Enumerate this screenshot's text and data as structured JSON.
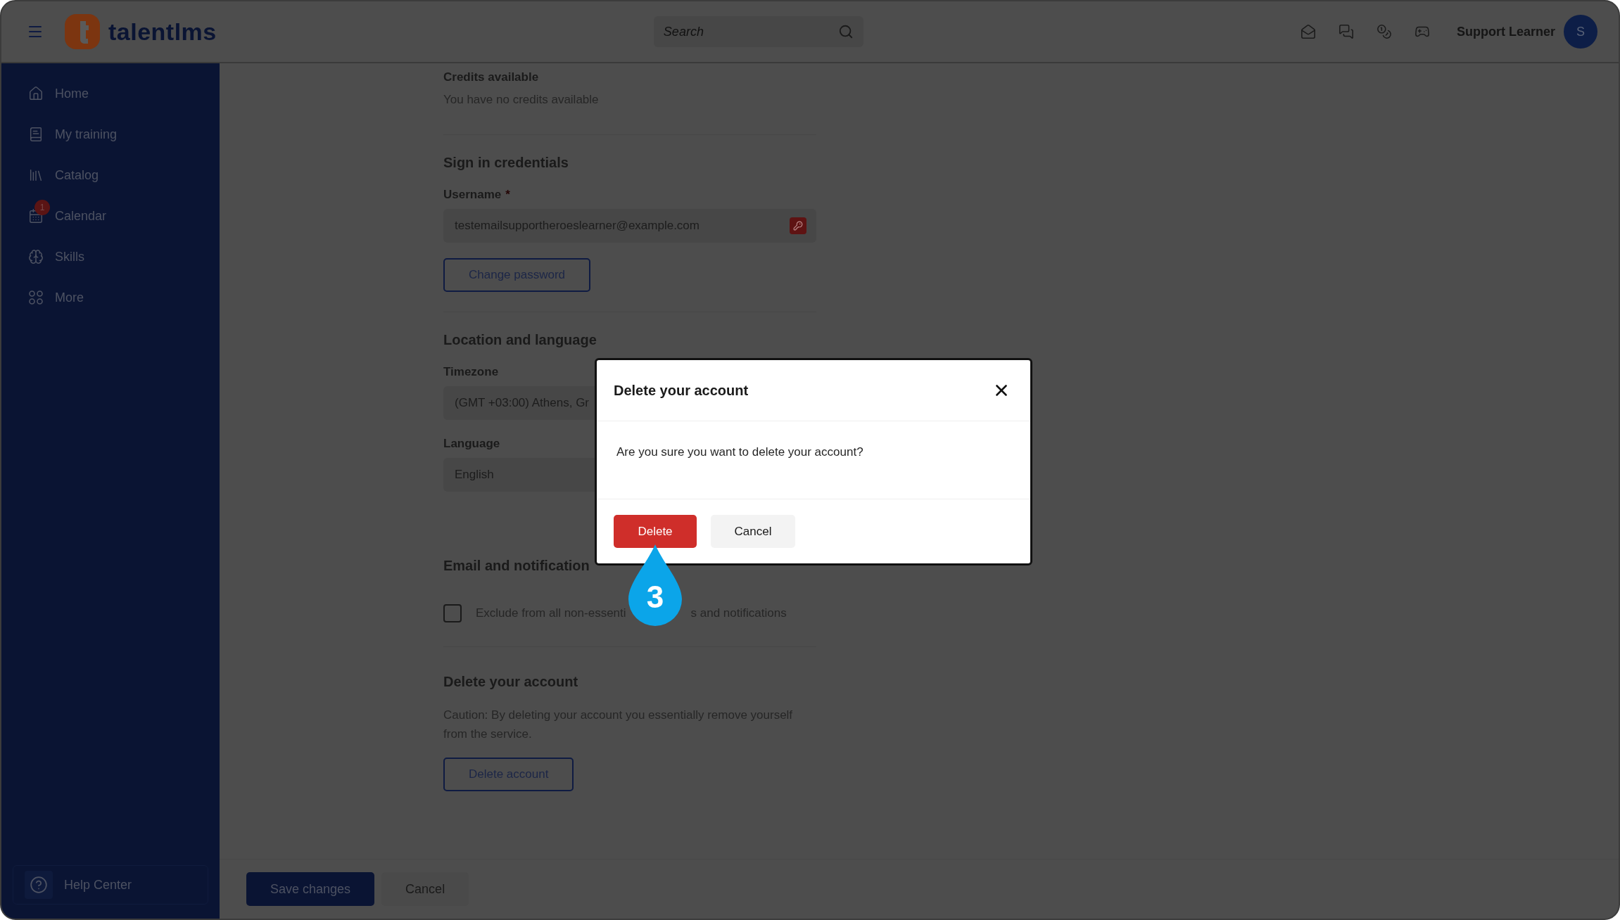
{
  "topbar": {
    "logo_text": "talentlms",
    "search": {
      "placeholder": "Search"
    },
    "user_name": "Support Learner",
    "avatar_initial": "S"
  },
  "sidebar": {
    "items": [
      {
        "kind": "home",
        "label": "Home"
      },
      {
        "kind": "training",
        "label": "My training"
      },
      {
        "kind": "catalog",
        "label": "Catalog"
      },
      {
        "kind": "calendar",
        "label": "Calendar",
        "badge": "1"
      },
      {
        "kind": "skills",
        "label": "Skills"
      },
      {
        "kind": "more",
        "label": "More"
      }
    ],
    "help": "Help Center"
  },
  "credits": {
    "title": "Credits available",
    "text": "You have no credits available"
  },
  "credentials": {
    "title": "Sign in credentials",
    "username_label": "Username",
    "required_mark": "*",
    "username_value": "testemailsupportheroeslearner@example.com",
    "change_password": "Change password"
  },
  "location": {
    "title": "Location and language",
    "timezone_label": "Timezone",
    "timezone_value": "(GMT +03:00) Athens, Gr",
    "language_label": "Language",
    "language_value": "English"
  },
  "notifications": {
    "title": "Email and notification",
    "checkbox": {
      "checked": false,
      "label_parts": [
        "Exclude from all non-essenti",
        "s and notifications"
      ]
    }
  },
  "delete_section": {
    "title": "Delete your account",
    "caution": "Caution: By deleting your account you essentially remove yourself from the service.",
    "button": "Delete account"
  },
  "footer": {
    "save": "Save changes",
    "cancel": "Cancel"
  },
  "modal": {
    "title": "Delete your account",
    "message": "Are you sure you want to delete your account?",
    "confirm": "Delete",
    "cancel": "Cancel"
  },
  "step_marker": {
    "number": "3"
  }
}
